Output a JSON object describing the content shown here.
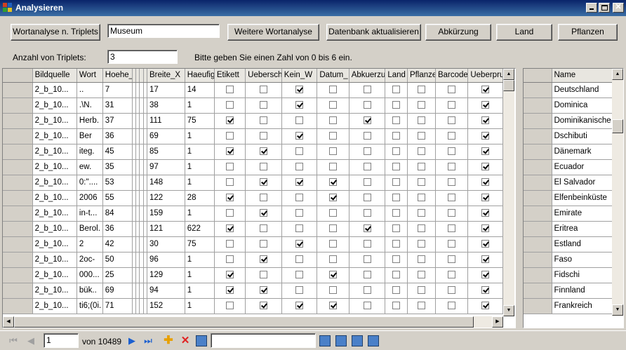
{
  "window": {
    "title": "Analysieren"
  },
  "toolbar_buttons": {
    "wortanalyse": "Wortanalyse n. Triplets",
    "weitere": "Weitere Wortanalyse",
    "datenbank": "Datenbank aktualisieren",
    "abkuerzung": "Abkürzung",
    "land": "Land",
    "pflanzen": "Pflanzen"
  },
  "search_field": {
    "value": "Museum"
  },
  "triplets": {
    "label": "Anzahl von Triplets:",
    "value": "3",
    "hint": "Bitte geben Sie einen Zahl von 0 bis 6 ein."
  },
  "main_grid": {
    "columns": [
      "Bildquelle",
      "Wort",
      "Hoehe_Y",
      "Breite_X",
      "Haeufig",
      "Etikett",
      "Ueberschr",
      "Kein_W",
      "Datum_",
      "Abkuerzu",
      "Land",
      "Pflanze",
      "Barcode",
      "Ueberpru"
    ],
    "rows": [
      {
        "bildquelle": "2_b_10...",
        "wort": "..",
        "hoehe": "7",
        "breite": "17",
        "haeufig": "14",
        "checks": [
          false,
          false,
          true,
          false,
          false,
          false,
          false,
          false,
          true
        ]
      },
      {
        "bildquelle": "2_b_10...",
        "wort": ".\\N.",
        "hoehe": "31",
        "breite": "38",
        "haeufig": "1",
        "checks": [
          false,
          false,
          true,
          false,
          false,
          false,
          false,
          false,
          true
        ]
      },
      {
        "bildquelle": "2_b_10...",
        "wort": "Herb.",
        "hoehe": "37",
        "breite": "111",
        "haeufig": "75",
        "checks": [
          true,
          false,
          false,
          false,
          true,
          false,
          false,
          false,
          true
        ]
      },
      {
        "bildquelle": "2_b_10...",
        "wort": "Ber",
        "hoehe": "36",
        "breite": "69",
        "haeufig": "1",
        "checks": [
          false,
          false,
          true,
          false,
          false,
          false,
          false,
          false,
          true
        ]
      },
      {
        "bildquelle": "2_b_10...",
        "wort": "iteg.",
        "hoehe": "45",
        "breite": "85",
        "haeufig": "1",
        "checks": [
          true,
          true,
          false,
          false,
          false,
          false,
          false,
          false,
          true
        ]
      },
      {
        "bildquelle": "2_b_10...",
        "wort": "ew.",
        "hoehe": "35",
        "breite": "97",
        "haeufig": "1",
        "checks": [
          false,
          false,
          false,
          false,
          false,
          false,
          false,
          false,
          true
        ]
      },
      {
        "bildquelle": "2_b_10...",
        "wort": "0:\"....",
        "hoehe": "53",
        "breite": "148",
        "haeufig": "1",
        "checks": [
          false,
          true,
          true,
          true,
          false,
          false,
          false,
          false,
          true
        ]
      },
      {
        "bildquelle": "2_b_10...",
        "wort": "2006",
        "hoehe": "55",
        "breite": "122",
        "haeufig": "28",
        "checks": [
          true,
          false,
          false,
          true,
          false,
          false,
          false,
          false,
          true
        ]
      },
      {
        "bildquelle": "2_b_10...",
        "wort": "in-t...",
        "hoehe": "84",
        "breite": "159",
        "haeufig": "1",
        "checks": [
          false,
          true,
          false,
          false,
          false,
          false,
          false,
          false,
          true
        ]
      },
      {
        "bildquelle": "2_b_10...",
        "wort": "Berol.",
        "hoehe": "36",
        "breite": "121",
        "haeufig": "622",
        "checks": [
          true,
          false,
          false,
          false,
          true,
          false,
          false,
          false,
          true
        ]
      },
      {
        "bildquelle": "2_b_10...",
        "wort": "2",
        "hoehe": "42",
        "breite": "30",
        "haeufig": "75",
        "checks": [
          false,
          false,
          true,
          false,
          false,
          false,
          false,
          false,
          true
        ]
      },
      {
        "bildquelle": "2_b_10...",
        "wort": "2oc-",
        "hoehe": "50",
        "breite": "96",
        "haeufig": "1",
        "checks": [
          false,
          true,
          false,
          false,
          false,
          false,
          false,
          false,
          true
        ]
      },
      {
        "bildquelle": "2_b_10...",
        "wort": "000...",
        "hoehe": "25",
        "breite": "129",
        "haeufig": "1",
        "checks": [
          true,
          false,
          false,
          true,
          false,
          false,
          false,
          false,
          true
        ]
      },
      {
        "bildquelle": "2_b_10...",
        "wort": "bük..",
        "hoehe": "69",
        "breite": "94",
        "haeufig": "1",
        "checks": [
          true,
          true,
          false,
          false,
          false,
          false,
          false,
          false,
          true
        ]
      },
      {
        "bildquelle": "2_b_10...",
        "wort": "ti6;(0i.",
        "hoehe": "71",
        "breite": "152",
        "haeufig": "1",
        "checks": [
          false,
          true,
          true,
          true,
          false,
          false,
          false,
          false,
          true
        ]
      }
    ]
  },
  "country_grid": {
    "column": "Name",
    "rows": [
      "Deutschland",
      "Dominica",
      "Dominikanische ...",
      "Dschibuti",
      "Dänemark",
      "Ecuador",
      "El Salvador",
      "Elfenbeinküste",
      "Emirate",
      "Eritrea",
      "Estland",
      "Faso",
      "Fidschi",
      "Finnland",
      "Frankreich"
    ]
  },
  "navigator": {
    "position": "1",
    "count": "von 10489"
  }
}
